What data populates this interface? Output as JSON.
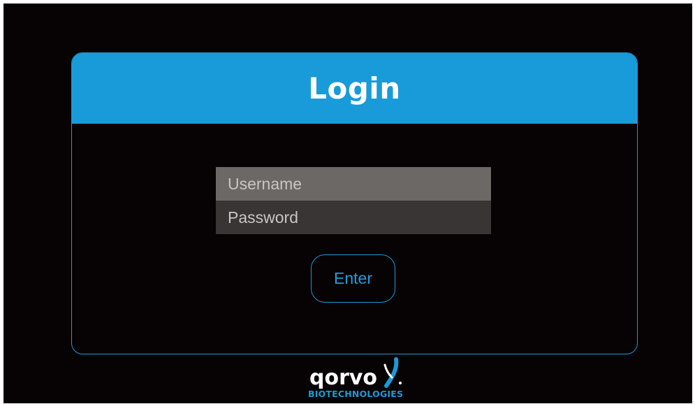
{
  "login": {
    "title": "Login",
    "username_placeholder": "Username",
    "password_placeholder": "Password",
    "enter_label": "Enter"
  },
  "brand": {
    "name": "qorvo",
    "subtitle": "BIOTECHNOLOGIES",
    "icon": "qorvo-dna-icon"
  },
  "colors": {
    "background": "#070203",
    "accent": "#189bd8",
    "username_field": "#6b6866",
    "password_field": "#393534"
  }
}
